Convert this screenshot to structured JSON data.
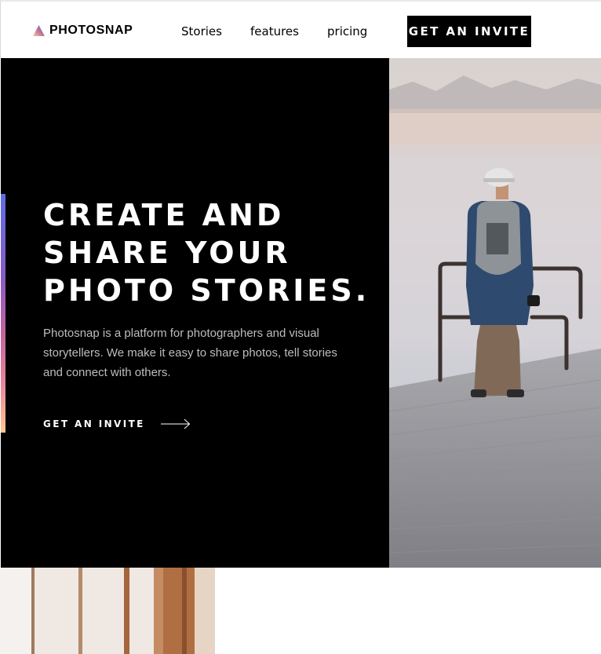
{
  "brand": {
    "name": "PHOTOSNAP",
    "logo_icon": "triangle-gradient-logo",
    "gradient_colors": [
      "#ffc593",
      "#bc7198",
      "#5a77ff"
    ]
  },
  "nav": {
    "items": [
      {
        "label": "Stories"
      },
      {
        "label": "features"
      },
      {
        "label": "pricing"
      }
    ],
    "cta_label": "GET AN INVITE"
  },
  "hero": {
    "title_lines": [
      "CREATE AND",
      "SHARE YOUR",
      "PHOTO STORIES."
    ],
    "description": "Photosnap is a platform for photographers and visual storytellers. We make it easy to share photos, tell stories and connect with others.",
    "cta_label": "GET AN INVITE",
    "cta_icon": "arrow-right-icon",
    "background_color": "#000000",
    "photo_subject": "man with backpack and camera standing on a pier by a misty lake"
  },
  "sections": {
    "next_photo": "close-up of wooden posts"
  }
}
